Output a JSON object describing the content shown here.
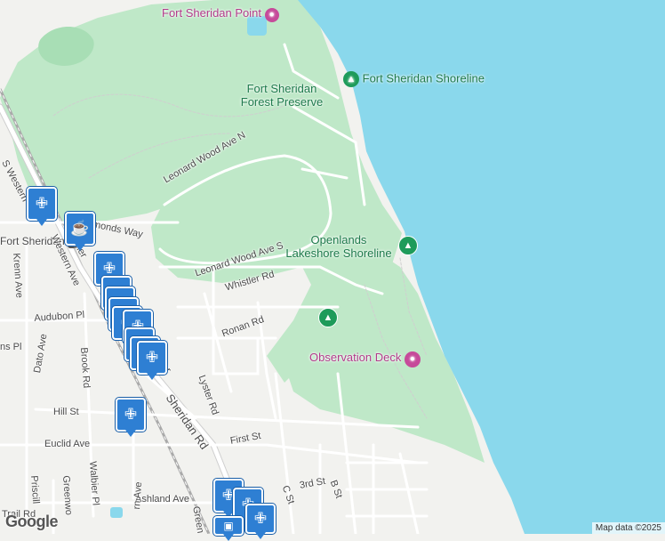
{
  "map": {
    "colors": {
      "water": "#8ad8ec",
      "park": "#bfe8c8",
      "land": "#f2f2ef",
      "road": "#ffffff",
      "road_outline": "#cfcfcf",
      "rail": "#aaaaaa",
      "pin": "#2e7fd3"
    },
    "pois": [
      {
        "id": "fort-sheridan-point",
        "label": "Fort Sheridan Point",
        "icon": "camera-icon"
      },
      {
        "id": "fort-sheridan-shoreline",
        "label": "Fort Sheridan Shoreline",
        "icon": "tree-icon"
      },
      {
        "id": "openlands-lakeshore",
        "label": "Openlands\nLakeshore Shoreline",
        "icon": "tree-icon"
      },
      {
        "id": "observation-deck",
        "label": "Observation Deck",
        "icon": "camera-icon"
      },
      {
        "id": "fort-sheridan-station",
        "label": "Fort Sheridan",
        "icon": "train-icon"
      }
    ],
    "parks": [
      {
        "id": "forest-preserve",
        "label": "Fort Sheridan\nForest Preserve"
      }
    ],
    "streets": [
      {
        "id": "leonard-wood-n",
        "label": "Leonard Wood Ave N"
      },
      {
        "id": "leonard-wood-s",
        "label": "Leonard Wood Ave S"
      },
      {
        "id": "whistler",
        "label": "Whistler Rd"
      },
      {
        "id": "ronan",
        "label": "Ronan Rd"
      },
      {
        "id": "lyster",
        "label": "Lyster Rd"
      },
      {
        "id": "sheridan",
        "label": "Sheridan Rd"
      },
      {
        "id": "first",
        "label": "First St"
      },
      {
        "id": "third",
        "label": "3rd St"
      },
      {
        "id": "b-st",
        "label": "B St"
      },
      {
        "id": "c-st",
        "label": "C St"
      },
      {
        "id": "audubon",
        "label": "Audubon Pl"
      },
      {
        "id": "hill",
        "label": "Hill St"
      },
      {
        "id": "euclid",
        "label": "Euclid Ave"
      },
      {
        "id": "ashland",
        "label": "Ashland Ave"
      },
      {
        "id": "western",
        "label": "Western Ave"
      },
      {
        "id": "s-western",
        "label": "S Western"
      },
      {
        "id": "krenn",
        "label": "Krenn Ave"
      },
      {
        "id": "dato",
        "label": "Dato Ave"
      },
      {
        "id": "brook",
        "label": "Brook Rd"
      },
      {
        "id": "walbier",
        "label": "Walbier Pl"
      },
      {
        "id": "priscilla",
        "label": "Priscill"
      },
      {
        "id": "greenwood",
        "label": "Greenwo"
      },
      {
        "id": "trail",
        "label": "Trail Rd"
      },
      {
        "id": "symonds",
        "label": "ymonds Way"
      },
      {
        "id": "ner",
        "label": "ner"
      },
      {
        "id": "ver",
        "label": "ver"
      },
      {
        "id": "ms-pl",
        "label": "ns Pl"
      },
      {
        "id": "rn-ave",
        "label": "rn Ave"
      },
      {
        "id": "green",
        "label": "Green"
      }
    ],
    "pins": [
      {
        "type": "restaurant",
        "icon": "fork-knife-icon"
      },
      {
        "type": "cafe",
        "icon": "coffee-cup-icon"
      },
      {
        "type": "restaurant",
        "icon": "fork-knife-icon"
      },
      {
        "type": "restaurant",
        "icon": "fork-knife-icon"
      },
      {
        "type": "restaurant",
        "icon": "fork-knife-icon"
      },
      {
        "type": "restaurant",
        "icon": "fork-knife-icon"
      },
      {
        "type": "restaurant",
        "icon": "fork-knife-icon"
      },
      {
        "type": "restaurant",
        "icon": "fork-knife-icon"
      },
      {
        "type": "restaurant",
        "icon": "fork-knife-icon"
      },
      {
        "type": "restaurant",
        "icon": "fork-knife-icon"
      },
      {
        "type": "restaurant",
        "icon": "fork-knife-icon"
      },
      {
        "type": "restaurant",
        "icon": "fork-knife-icon"
      },
      {
        "type": "restaurant",
        "icon": "fork-knife-icon"
      },
      {
        "type": "shopping",
        "icon": "cart-icon"
      }
    ],
    "logo": "Google",
    "attribution": "Map data ©2025"
  }
}
